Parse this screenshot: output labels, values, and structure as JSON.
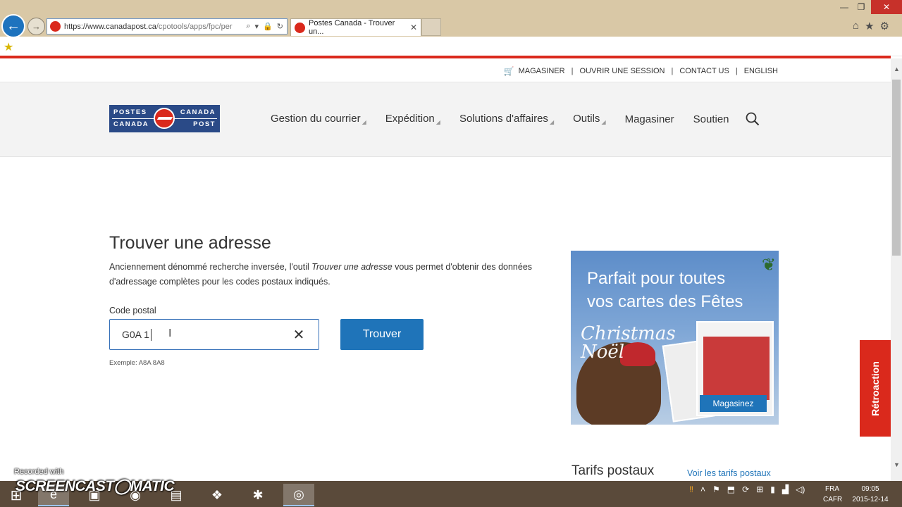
{
  "browser": {
    "url_main": "https://www.canadapost.ca",
    "url_rest": "/cpotools/apps/fpc/per",
    "tab_title": "Postes Canada - Trouver un...",
    "tab_close": "✕"
  },
  "utility": {
    "shop": "MAGASINER",
    "login": "OUVRIR UNE SESSION",
    "contact": "CONTACT US",
    "language": "ENGLISH",
    "sep": "|"
  },
  "logo": {
    "line1_left": "POSTES",
    "line1_right": "CANADA",
    "line2_left": "CANADA",
    "line2_right": "POST"
  },
  "nav": {
    "items": [
      {
        "label": "Gestion du courrier",
        "caret": "◢"
      },
      {
        "label": "Expédition",
        "caret": "◢"
      },
      {
        "label": "Solutions d'affaires",
        "caret": "◢"
      },
      {
        "label": "Outils",
        "caret": "◢"
      },
      {
        "label": "Magasiner",
        "caret": ""
      },
      {
        "label": "Soutien",
        "caret": ""
      }
    ]
  },
  "main": {
    "title": "Trouver une adresse",
    "desc_before": "Anciennement dénommé recherche inversée, l'outil ",
    "desc_em": "Trouver une adresse",
    "desc_after": " vous permet d'obtenir des données d'adressage complètes pour les codes postaux indiqués.",
    "field_label": "Code postal",
    "field_value": "G0A 1",
    "clear_glyph": "✕",
    "button": "Trouver",
    "hint": "Exemple: A8A 8A8"
  },
  "promo": {
    "headline_1": "Parfait pour toutes",
    "headline_2": "vos cartes des Fêtes",
    "script_1": "Christmas",
    "script_2": "Noël",
    "shop_button": "Magasinez"
  },
  "rates": {
    "title": "Tarifs postaux",
    "link": "Voir les tarifs postaux"
  },
  "feedback": "Rétroaction",
  "taskbar": {
    "recorded_with": "Recorded with",
    "screencast": "SCREENCAST◯MATIC",
    "lang_1": "FRA",
    "lang_2": "CAFR",
    "time": "09:05",
    "date": "2015-12-14"
  }
}
